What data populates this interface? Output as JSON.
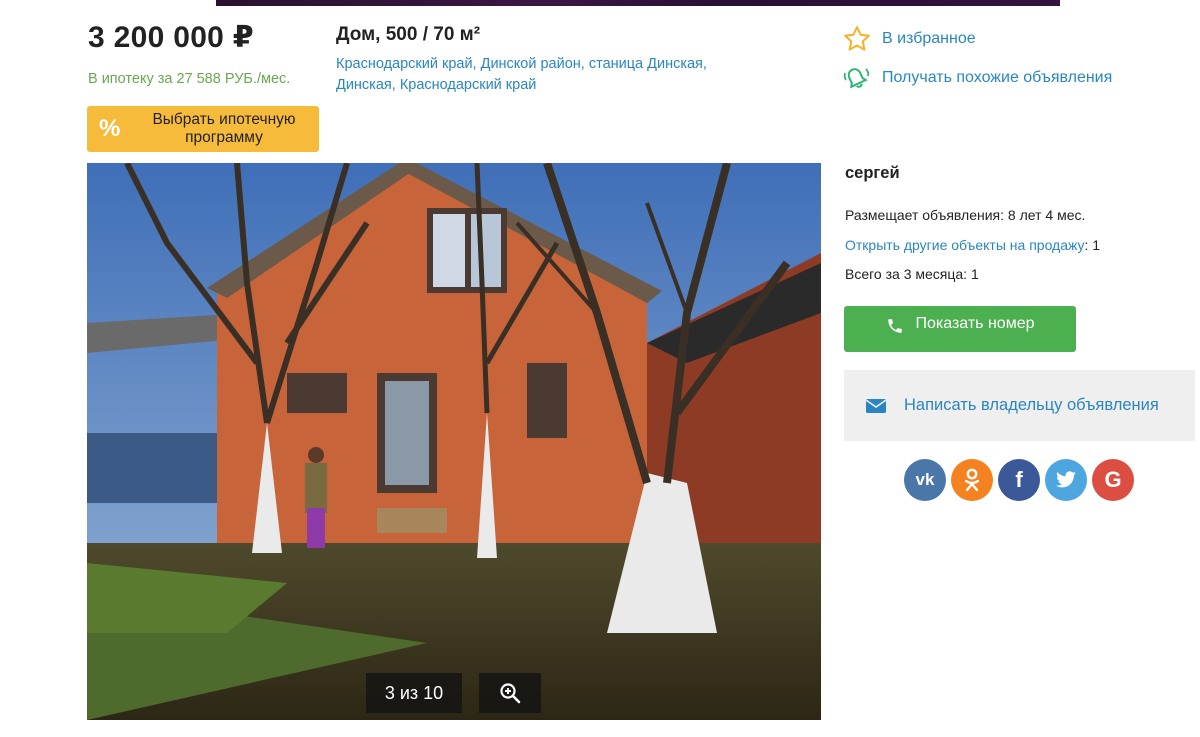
{
  "listing": {
    "price": "3 200 000 ₽",
    "mortgage_text": "В ипотеку за 27 588 РУБ./мес.",
    "mortgage_button": {
      "icon": "%",
      "label": "Выбрать ипотечную программу"
    },
    "title": "Дом, 500 / 70 м²",
    "address": "Краснодарский край, Динской район, станица Динская, Динская, Краснодарский край"
  },
  "actions": {
    "favorite_label": "В избранное",
    "similar_label": "Получать похожие объявления"
  },
  "gallery": {
    "counter": "3 из 10",
    "icons": [
      "zoom-in-icon"
    ]
  },
  "seller": {
    "name": "сергей",
    "tenure_label": "Размещает объявления:",
    "tenure_value": "8 лет 4 мес.",
    "other_link": "Открыть другие объекты на продажу",
    "other_count": ": 1",
    "total_label": "Всего за 3 месяца: 1",
    "phone_button": "Показать номер",
    "write_button": "Написать владельцу объявления"
  },
  "social": [
    {
      "name": "vk",
      "glyph": "vk",
      "color": "#4a76a8"
    },
    {
      "name": "odnoklassniki",
      "glyph": "ok",
      "color": "#f58220"
    },
    {
      "name": "facebook",
      "glyph": "f",
      "color": "#3b5998"
    },
    {
      "name": "twitter",
      "glyph": "tw",
      "color": "#4ea6e0"
    },
    {
      "name": "google",
      "glyph": "G",
      "color": "#dc4e41"
    }
  ],
  "colors": {
    "link": "#2a86c2",
    "mortgage_green": "#6aa84f",
    "mortgage_button": "#f7bb3c",
    "phone_button": "#4caf50"
  }
}
